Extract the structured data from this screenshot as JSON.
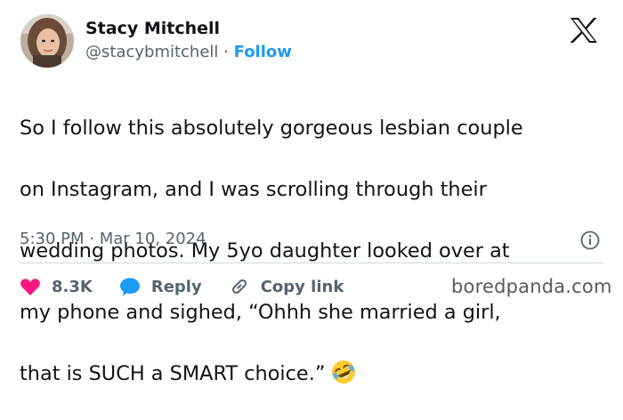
{
  "author": {
    "name": "Stacy Mitchell",
    "handle": "@stacybmitchell",
    "separator": "·",
    "follow_label": "Follow"
  },
  "tweet": {
    "lines": [
      "So I follow this absolutely gorgeous lesbian couple",
      "on Instagram, and I was scrolling through their",
      "wedding photos. My 5yo daughter looked over at",
      "my phone and sighed, “Ohhh she married a girl,",
      "that is SUCH a SMART choice.”"
    ],
    "emoji": "rolling-on-floor-laughing-emoji"
  },
  "meta": {
    "time": "5:30 PM",
    "separator": "·",
    "date": "Mar 10, 2024"
  },
  "actions": {
    "likes_count": "8.3K",
    "reply_label": "Reply",
    "copy_link_label": "Copy link"
  },
  "watermark": "boredpanda.com",
  "colors": {
    "text": "#0f1419",
    "secondary": "#536471",
    "link": "#1d9bf0",
    "like": "#f91880",
    "reply": "#1d9bf0",
    "divider": "#cfd9de"
  }
}
